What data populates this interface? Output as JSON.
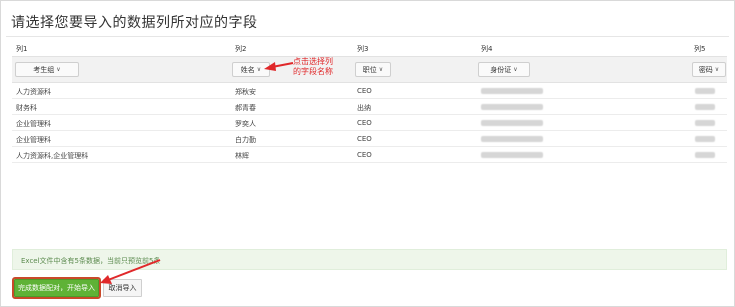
{
  "title": "请选择您要导入的数据列所对应的字段",
  "columns": [
    "列1",
    "列2",
    "列3",
    "列4",
    "列5"
  ],
  "field_selects": [
    "考生组",
    "姓名",
    "职位",
    "身份证",
    "密码"
  ],
  "rows": [
    [
      "人力资源科",
      "郑秋安",
      "CEO"
    ],
    [
      "财务科",
      "郝青春",
      "出纳"
    ],
    [
      "企业管理科",
      "罗奕人",
      "CEO"
    ],
    [
      "企业管理科",
      "白力勤",
      "CEO"
    ],
    [
      "人力资源科,企业管理科",
      "林辉",
      "CEO"
    ]
  ],
  "annotation": {
    "line1": "点击选择列",
    "line2": "的字段名称"
  },
  "info_text": "Excel文件中含有5条数据，当前只预览前5条",
  "buttons": {
    "confirm": "完成数据配对，开始导入",
    "cancel": "取消导入"
  },
  "colors": {
    "primary": "#5fb236",
    "annotation": "#e0282a",
    "info_bg": "#eef6ea"
  }
}
